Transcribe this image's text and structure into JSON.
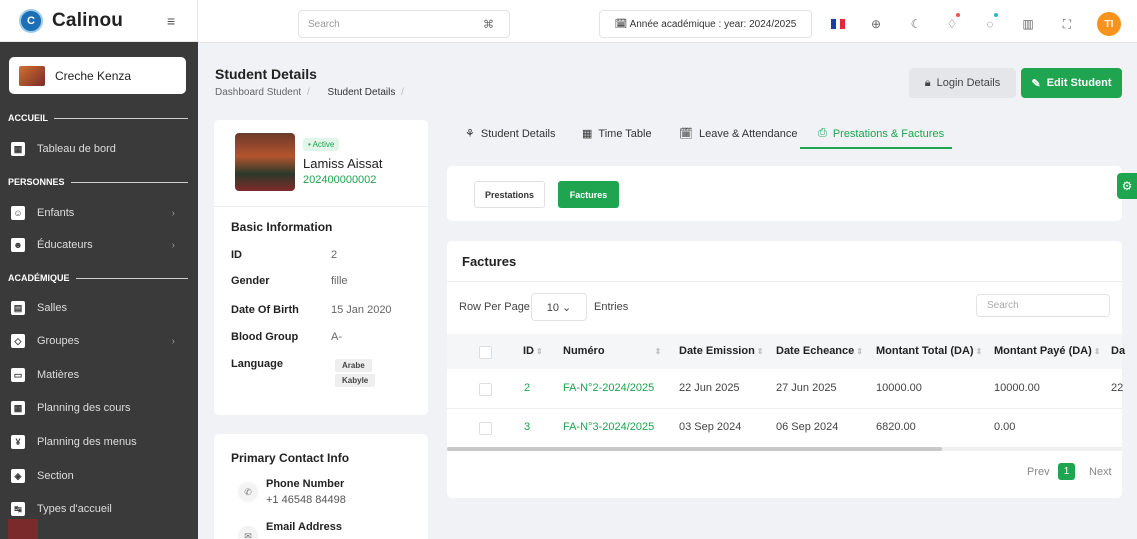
{
  "app": {
    "name": "Calinou",
    "logo_letter": "C",
    "menu_icon": "hamburger-icon",
    "school": "Creche Kenza"
  },
  "sidebar": {
    "sections": [
      {
        "title": "ACCUEIL"
      },
      {
        "title": "PERSONNES"
      },
      {
        "title": "ACADÉMIQUE"
      }
    ],
    "items": [
      {
        "label": "Tableau de bord",
        "icon": "dashboard-icon",
        "glyph": "▦"
      },
      {
        "label": "Enfants",
        "icon": "child-icon",
        "glyph": "☺",
        "arrow": "›"
      },
      {
        "label": "Éducateurs",
        "icon": "teachers-icon",
        "glyph": "☻",
        "arrow": "›"
      },
      {
        "label": "Salles",
        "icon": "classroom-icon",
        "glyph": "▤"
      },
      {
        "label": "Groupes",
        "icon": "groups-icon",
        "glyph": "◇",
        "arrow": "›"
      },
      {
        "label": "Matières",
        "icon": "subjects-icon",
        "glyph": "▭"
      },
      {
        "label": "Planning des cours",
        "icon": "schedule-icon",
        "glyph": "▦"
      },
      {
        "label": "Planning des menus",
        "icon": "menu-plan-icon",
        "glyph": "¥"
      },
      {
        "label": "Section",
        "icon": "section-icon",
        "glyph": "◈"
      },
      {
        "label": "Types d'accueil",
        "icon": "reception-types-icon",
        "glyph": "↹"
      }
    ]
  },
  "topbar": {
    "search_placeholder": "Search",
    "search_shortcut": "⌘",
    "year_label": "🗓 Année académique : year: 2024/2025",
    "avatar": "TI",
    "icons": [
      "flag-icon",
      "plus-circle-icon",
      "moon-icon",
      "bell-icon",
      "chat-icon",
      "chart-icon",
      "fullscreen-icon"
    ]
  },
  "page": {
    "title": "Student Details",
    "breadcrumb": [
      "Dashboard",
      "Student",
      "Student Details"
    ],
    "login_btn": "Login Details",
    "edit_btn": "Edit Student",
    "login_glyph": "🔒︎",
    "edit_glyph": "✎"
  },
  "student": {
    "status": "• Active",
    "name": "Lamiss Aissat",
    "id_code": "202400000002"
  },
  "basic_info": {
    "title": "Basic Information",
    "rows": [
      {
        "label": "ID",
        "value": "2"
      },
      {
        "label": "Gender",
        "value": "fille"
      },
      {
        "label": "Date Of Birth",
        "value": "15 Jan 2020"
      },
      {
        "label": "Blood Group",
        "value": "A-"
      },
      {
        "label": "Language",
        "value": ""
      }
    ],
    "languages": [
      "Arabe",
      "Kabyle"
    ]
  },
  "contact": {
    "title": "Primary Contact Info",
    "phone_label": "Phone Number",
    "phone": "+1 46548 84498",
    "email_label": "Email Address"
  },
  "tabs": [
    {
      "label": "Student Details",
      "glyph": "⚘"
    },
    {
      "label": "Time Table",
      "glyph": "▦"
    },
    {
      "label": "Leave & Attendance",
      "glyph": "🗓"
    },
    {
      "label": "Prestations & Factures",
      "glyph": "⎙"
    }
  ],
  "subtabs": {
    "prestations": "Prestations",
    "factures": "Factures"
  },
  "factures": {
    "title": "Factures",
    "row_per_page_label": "Row Per Page",
    "row_per_page_value": "10 ⌄",
    "entries_label": "Entries",
    "search_placeholder": "Search",
    "columns": [
      "ID",
      "Numéro",
      "Date Emission",
      "Date Echeance",
      "Montant Total (DA)",
      "Montant Payé (DA)",
      "Da"
    ],
    "rows": [
      {
        "id": "2",
        "numero": "FA-N°2-2024/2025",
        "emission": "22 Jun 2025",
        "echeance": "27 Jun 2025",
        "total": "10000.00",
        "paye": "10000.00",
        "extra": "22"
      },
      {
        "id": "3",
        "numero": "FA-N°3-2024/2025",
        "emission": "03 Sep 2024",
        "echeance": "06 Sep 2024",
        "total": "6820.00",
        "paye": "0.00",
        "extra": ""
      }
    ],
    "pagination": {
      "prev": "Prev",
      "current": "1",
      "next": "Next"
    }
  }
}
